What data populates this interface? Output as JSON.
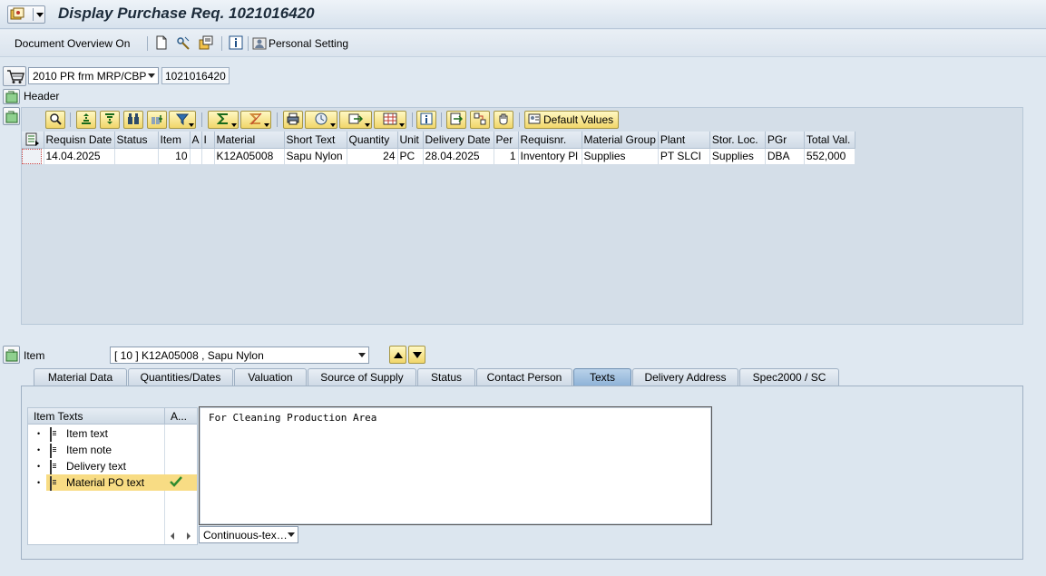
{
  "window": {
    "title": "Display Purchase Req. 1021016420"
  },
  "toolbar": {
    "document_overview": "Document Overview On",
    "personal_setting": "Personal Setting"
  },
  "header": {
    "doc_type": "2010 PR frm MRP/CBP",
    "doc_number": "1021016420",
    "header_label": "Header"
  },
  "grid": {
    "default_values": "Default Values",
    "columns": [
      "Requisn Date",
      "Status",
      "Item",
      "A",
      "I",
      "Material",
      "Short Text",
      "Quantity",
      "Unit",
      "Delivery Date",
      "Per",
      "Requisnr.",
      "Material Group",
      "Plant",
      "Stor. Loc.",
      "PGr",
      "Total Val."
    ],
    "rows": [
      {
        "requisn_date": "14.04.2025",
        "status": "",
        "item": "10",
        "a": "",
        "i": "",
        "material": "K12A05008",
        "short_text": "Sapu Nylon",
        "quantity": "24",
        "unit": "PC",
        "delivery_date": "28.04.2025",
        "per": "1",
        "requisnr": "Inventory Pl",
        "material_group": "Supplies",
        "plant": "PT SLCI",
        "stor_loc": "Supplies",
        "pgr": "DBA",
        "total_val": "552,000"
      }
    ]
  },
  "item_section": {
    "label": "Item",
    "selected": "[ 10 ] K12A05008 , Sapu Nylon"
  },
  "tabs": [
    {
      "label": "Material Data",
      "active": false
    },
    {
      "label": "Quantities/Dates",
      "active": false
    },
    {
      "label": "Valuation",
      "active": false
    },
    {
      "label": "Source of Supply",
      "active": false
    },
    {
      "label": "Status",
      "active": false
    },
    {
      "label": "Contact Person",
      "active": false
    },
    {
      "label": "Texts",
      "active": true
    },
    {
      "label": "Delivery Address",
      "active": false
    },
    {
      "label": "Spec2000 / SC",
      "active": false
    }
  ],
  "texts": {
    "header_col1": "Item Texts",
    "header_col2": "A...",
    "items": [
      {
        "label": "Item text",
        "selected": false
      },
      {
        "label": "Item note",
        "selected": false
      },
      {
        "label": "Delivery text",
        "selected": false
      },
      {
        "label": "Material PO text",
        "selected": true
      }
    ],
    "editor_content": "For Cleaning Production Area",
    "format_select": "Continuous-tex…"
  },
  "colors": {
    "background": "#dfe8f1",
    "highlight": "#f8dc84",
    "active_tab": "#8fb3d8",
    "check": "#2e8b2e"
  }
}
